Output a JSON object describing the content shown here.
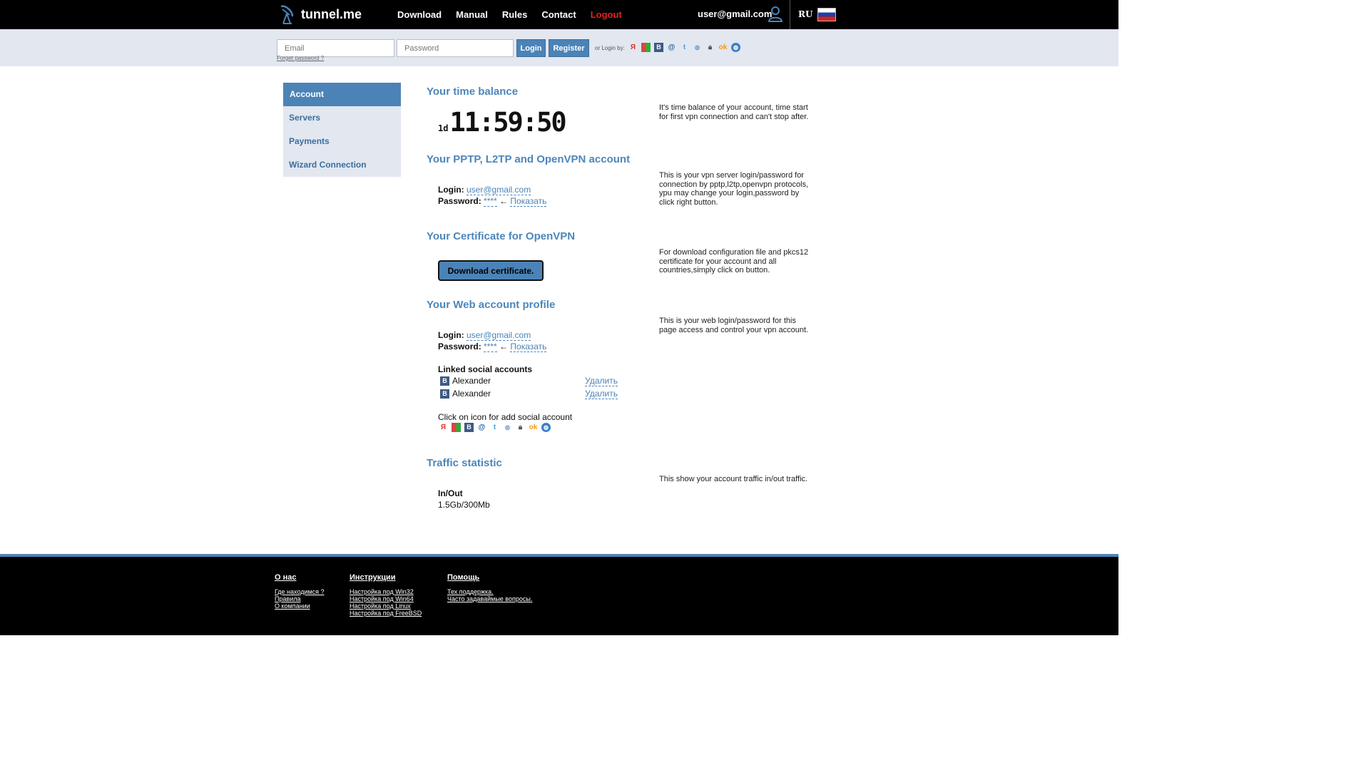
{
  "header": {
    "logo_text": "tunnel.me",
    "nav": [
      "Download",
      "Manual",
      "Rules",
      "Contact",
      "Logout"
    ],
    "user_email": "user@gmail.com",
    "lang": "RU"
  },
  "loginbar": {
    "email_placeholder": "Email",
    "password_placeholder": "Password",
    "login_label": "Login",
    "register_label": "Register",
    "or_login_by": "or Login by:",
    "forgot_password": "Forget password ?",
    "social_icons": [
      "yandex-icon",
      "google-icon",
      "vk-icon",
      "mailru-icon",
      "twitter-icon",
      "livejournal-icon",
      "openid-lock-icon",
      "odnoklassniki-icon",
      "globe-icon"
    ]
  },
  "sidebar": {
    "items": [
      {
        "label": "Account"
      },
      {
        "label": "Servers"
      },
      {
        "label": "Payments"
      },
      {
        "label": "Wizard Connection"
      }
    ]
  },
  "time_balance": {
    "title": "Your time balance",
    "days": "1d",
    "time": "11:59:50",
    "desc": "It's time balance of your account, time start for first vpn connection and can't stop after."
  },
  "vpn_account": {
    "title": "Your PPTP, L2TP and OpenVPN account",
    "login_label": "Login:",
    "login_value": "user@gmail.com",
    "password_label": "Password:",
    "password_mask": "****",
    "arrow": "←",
    "show_label": "Показать",
    "desc": "This is your vpn server login/password for connection by pptp,l2tp,openvpn protocols, ypu may change your login,password by click right button."
  },
  "certificate": {
    "title": "Your Certificate for OpenVPN",
    "button": "Download certificate.",
    "desc": "For download configuration file and pkcs12 certificate for your account and all countries,simply click on button."
  },
  "web_profile": {
    "title": "Your Web account profile",
    "login_label": "Login:",
    "login_value": "user@gmail.com",
    "password_label": "Password:",
    "password_mask": "****",
    "arrow": "←",
    "show_label": "Показать",
    "desc": "This is your web login/password for this page access and control your vpn account.",
    "linked_title": "Linked social accounts",
    "linked": [
      {
        "badge": "B",
        "name": "Alexander",
        "action": "Удалить"
      },
      {
        "badge": "B",
        "name": "Alexander",
        "action": "Удалить"
      }
    ],
    "add_social_text": "Click on icon for add social account"
  },
  "traffic": {
    "title": "Traffic statistic",
    "desc": "This show your account traffic in/out traffic.",
    "label": "In/Out",
    "value": "1.5Gb/300Mb"
  },
  "footer": {
    "columns": [
      {
        "heading": "О нас",
        "links": [
          "Где находимся ?",
          "Правила",
          "О компании"
        ]
      },
      {
        "heading": "Инструкции",
        "links": [
          "Настройка под Win32",
          "Настройка под Win64",
          "Настройка под Linux",
          "Настройка под FreeBSD"
        ]
      },
      {
        "heading": "Помощь",
        "links": [
          "Тех поддержка.",
          "Часто задаваймые вопросы."
        ]
      }
    ]
  },
  "colors": {
    "accent": "#4b83b7",
    "title": "#4d86ba",
    "logout": "#e8211a",
    "header_bg": "#000000",
    "bar_bg": "#e2e7f0"
  }
}
